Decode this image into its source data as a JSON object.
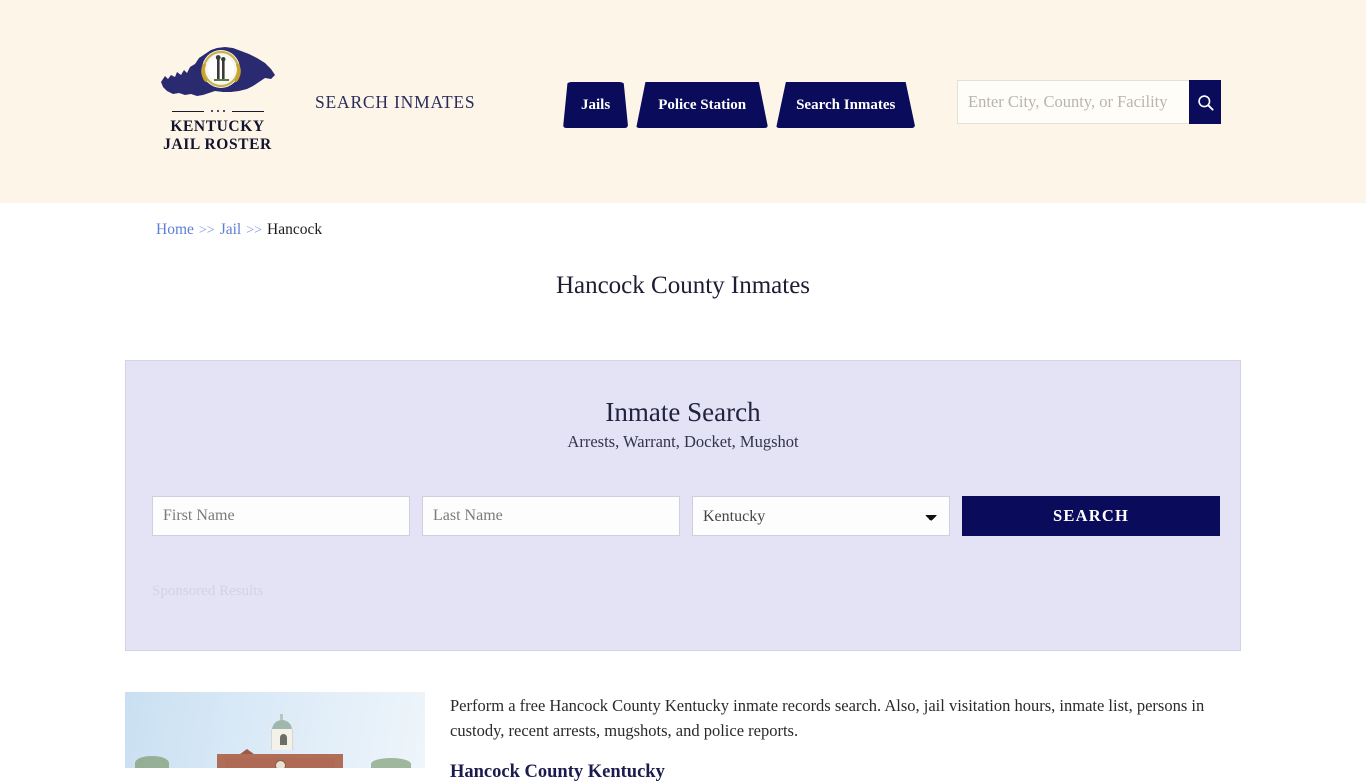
{
  "header": {
    "logo": {
      "icon": "kentucky-state-map-seal",
      "line1": "KENTUCKY",
      "line2": "JAIL ROSTER"
    },
    "tagline": "SEARCH INMATES",
    "nav": [
      {
        "label": "Jails"
      },
      {
        "label": "Police Station"
      },
      {
        "label": "Search Inmates"
      }
    ],
    "search": {
      "placeholder": "Enter City, County, or Facility",
      "value": "",
      "button_icon": "search-icon"
    },
    "bg_color": "#fdf6e8",
    "accent_color": "#0b0b5c"
  },
  "breadcrumb": {
    "items": [
      {
        "label": "Home",
        "link": true
      },
      {
        "label": "Jail",
        "link": true
      },
      {
        "label": "Hancock",
        "link": false
      }
    ],
    "separator": ">>"
  },
  "page": {
    "title": "Hancock County Inmates"
  },
  "search_panel": {
    "title": "Inmate Search",
    "subtitle": "Arrests, Warrant, Docket, Mugshot",
    "first_name_placeholder": "First Name",
    "first_name_value": "",
    "last_name_placeholder": "Last Name",
    "last_name_value": "",
    "state_selected": "Kentucky",
    "state_options": [
      "Kentucky"
    ],
    "search_button": "SEARCH",
    "sponsored_label": "Sponsored Results",
    "bg_color": "#e3e3f5"
  },
  "content": {
    "thumbnail_alt": "hancock-county-courthouse-photo",
    "paragraph": "Perform a free Hancock County Kentucky inmate records search. Also, jail visitation hours, inmate list, persons in custody, recent arrests, mugshots, and police reports.",
    "sub_heading": "Hancock County Kentucky"
  }
}
